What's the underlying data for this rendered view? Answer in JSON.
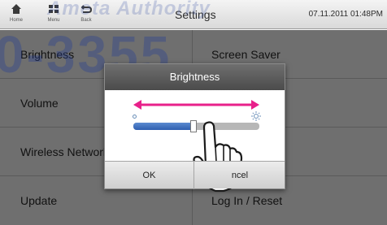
{
  "topbar": {
    "nav": [
      {
        "label": "Home",
        "icon": "home-icon"
      },
      {
        "label": "Menu",
        "icon": "menu-icon"
      },
      {
        "label": "Back",
        "icon": "back-icon"
      }
    ],
    "title": "Settings",
    "datetime": "07.11.2011 01:48PM"
  },
  "settings": {
    "items": [
      {
        "label": "Brightness"
      },
      {
        "label": "Screen Saver"
      },
      {
        "label": "Volume"
      },
      {
        "label": ""
      },
      {
        "label": "Wireless Network"
      },
      {
        "label": ""
      },
      {
        "label": "Update"
      },
      {
        "label": "Log In / Reset"
      }
    ]
  },
  "watermark": {
    "brand": "Ameta Authority",
    "number": "0-3355"
  },
  "dialog": {
    "title": "Brightness",
    "brightness_level": 0.48,
    "ok_label": "OK",
    "cancel_label": "ncel"
  },
  "colors": {
    "arrow": "#e8208a",
    "slider_fill": "#3c6cbc"
  }
}
